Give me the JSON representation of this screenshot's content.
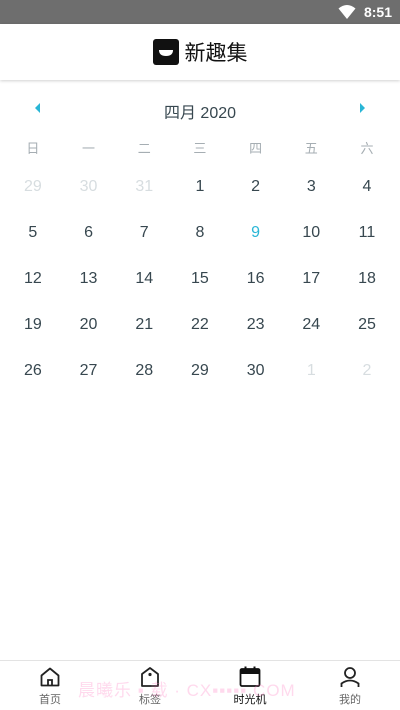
{
  "status_bar": {
    "time": "8:51"
  },
  "app_bar": {
    "title": "新趣集"
  },
  "calendar": {
    "month_title": "四月 2020",
    "weekdays": [
      "日",
      "一",
      "二",
      "三",
      "四",
      "五",
      "六"
    ],
    "days": [
      {
        "label": "29",
        "state": "other"
      },
      {
        "label": "30",
        "state": "other"
      },
      {
        "label": "31",
        "state": "other"
      },
      {
        "label": "1",
        "state": "normal"
      },
      {
        "label": "2",
        "state": "normal"
      },
      {
        "label": "3",
        "state": "normal"
      },
      {
        "label": "4",
        "state": "normal"
      },
      {
        "label": "5",
        "state": "normal"
      },
      {
        "label": "6",
        "state": "normal"
      },
      {
        "label": "7",
        "state": "normal"
      },
      {
        "label": "8",
        "state": "normal"
      },
      {
        "label": "9",
        "state": "today"
      },
      {
        "label": "10",
        "state": "normal"
      },
      {
        "label": "11",
        "state": "normal"
      },
      {
        "label": "12",
        "state": "normal"
      },
      {
        "label": "13",
        "state": "normal"
      },
      {
        "label": "14",
        "state": "normal"
      },
      {
        "label": "15",
        "state": "normal"
      },
      {
        "label": "16",
        "state": "normal"
      },
      {
        "label": "17",
        "state": "normal"
      },
      {
        "label": "18",
        "state": "normal"
      },
      {
        "label": "19",
        "state": "normal"
      },
      {
        "label": "20",
        "state": "normal"
      },
      {
        "label": "21",
        "state": "normal"
      },
      {
        "label": "22",
        "state": "normal"
      },
      {
        "label": "23",
        "state": "normal"
      },
      {
        "label": "24",
        "state": "normal"
      },
      {
        "label": "25",
        "state": "normal"
      },
      {
        "label": "26",
        "state": "normal"
      },
      {
        "label": "27",
        "state": "normal"
      },
      {
        "label": "28",
        "state": "normal"
      },
      {
        "label": "29",
        "state": "normal"
      },
      {
        "label": "30",
        "state": "normal"
      },
      {
        "label": "1",
        "state": "other"
      },
      {
        "label": "2",
        "state": "other"
      }
    ]
  },
  "tab_bar": {
    "tabs": [
      {
        "label": "首页",
        "icon": "home-icon",
        "active": false
      },
      {
        "label": "标签",
        "icon": "tag-icon",
        "active": false
      },
      {
        "label": "时光机",
        "icon": "calendar-icon",
        "active": true
      },
      {
        "label": "我的",
        "icon": "person-icon",
        "active": false
      }
    ]
  },
  "watermark": "晨曦乐 ▪ 载 · CX▪▪▪▪▪.COM",
  "colors": {
    "accent": "#29b6d6",
    "text": "#37474f",
    "muted": "#d7dde0",
    "status_bar": "#6e6e6e"
  }
}
